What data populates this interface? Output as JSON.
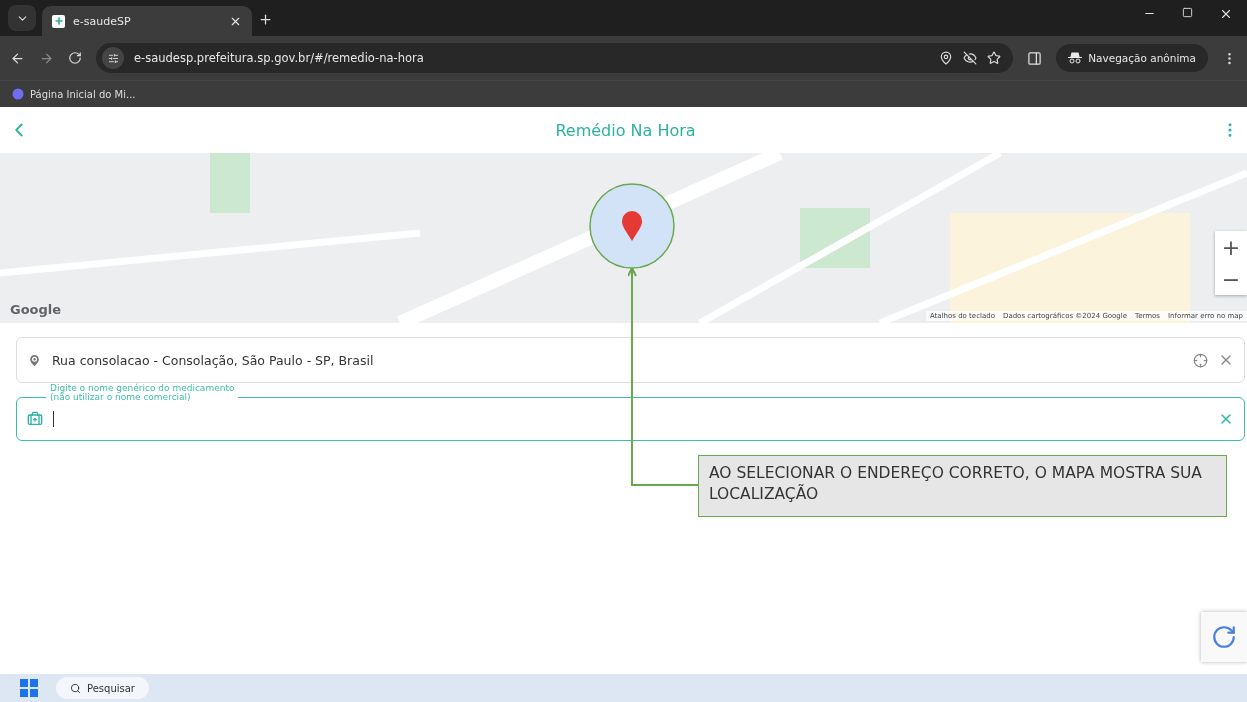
{
  "browser": {
    "tabs": [
      {
        "title": "e-saudeSP",
        "selected": true
      }
    ],
    "url": "e-saudesp.prefeitura.sp.gov.br/#/remedio-na-hora",
    "incognito_label": "Navegação anônima",
    "bookmarks": [
      {
        "label": "Página Inicial do Mi..."
      }
    ]
  },
  "page": {
    "title": "Remédio Na Hora"
  },
  "map": {
    "logo": "Google",
    "attribution": [
      "Atalhos do teclado",
      "Dados cartográficos ©2024 Google",
      "Termos",
      "Informar erro no map"
    ],
    "zoom_in": "+",
    "zoom_out": "−"
  },
  "address_field": {
    "value": "Rua consolacao - Consolação, São Paulo - SP, Brasil"
  },
  "medicine_field": {
    "label_lines": [
      "Digite o nome genérico do medicamento",
      "(não utilizar o nome comercial)"
    ],
    "focused": true
  },
  "callout": {
    "text": "AO SELECIONAR O ENDEREÇO CORRETO, O MAPA MOSTRA SUA LOCALIZAÇÃO"
  },
  "taskbar": {
    "search_placeholder": "Pesquisar"
  }
}
